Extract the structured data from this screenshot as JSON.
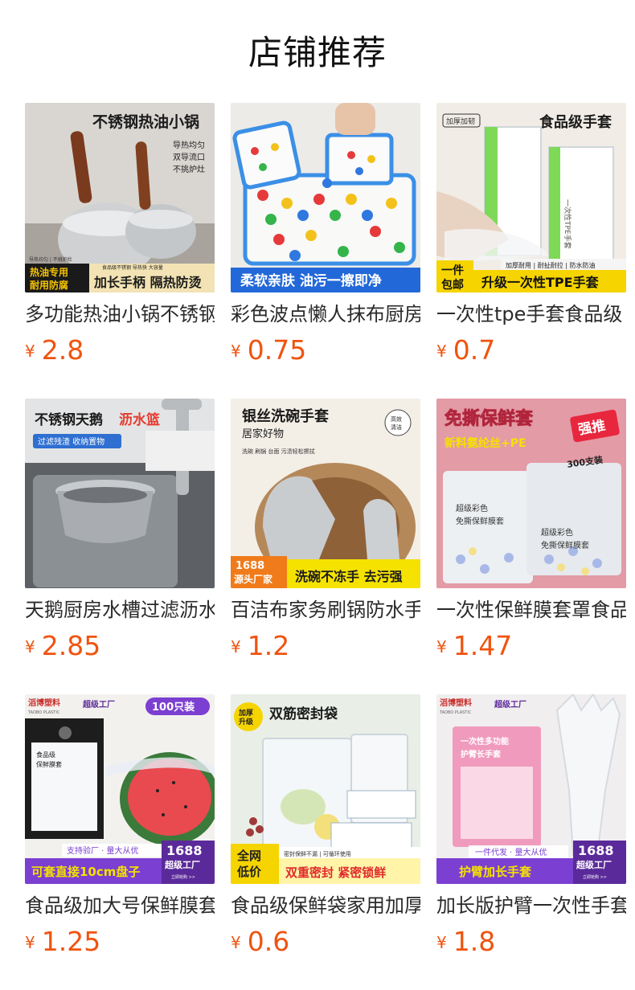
{
  "section": {
    "title": "店铺推荐"
  },
  "currency": "¥",
  "products": [
    {
      "name": "多功能热油小锅不锈钢",
      "price": "2.8",
      "image": {
        "headline": "不锈钢热油小锅",
        "bullets": [
          "导热均匀",
          "双导流口",
          "不挑炉灶"
        ],
        "tags": "导热均匀 | 不挑炉灶",
        "corner": [
          "热油专用",
          "耐用防腐"
        ],
        "subline": "食品级不锈钢 导热快 大容量",
        "banner": "加长手柄 隔热防烫"
      }
    },
    {
      "name": "彩色波点懒人抹布厨房",
      "price": "0.75",
      "image": {
        "banner": "柔软亲肤 油污一擦即净"
      }
    },
    {
      "name": "一次性tpe手套食品级",
      "price": "0.7",
      "image": {
        "badge": "加厚加韧",
        "headline": "食品级手套",
        "box_text": "一次性TPE手套",
        "mini_tags": "加厚耐用 | 耐扯耐拉 | 防水防油",
        "corner": [
          "一件",
          "包邮"
        ],
        "banner": "升级一次性TPE手套"
      }
    },
    {
      "name": "天鹅厨房水槽过滤沥水篮",
      "price": "2.85",
      "image": {
        "headline_main": "不锈钢天鹅",
        "headline_accent": "沥水篮",
        "subline": "过滤残渣 收纳置物"
      }
    },
    {
      "name": "百洁布家务刷锅防水手套",
      "price": "1.2",
      "image": {
        "headline": "银丝洗碗手套",
        "subhead": "居家好物",
        "uses": "洗碗 刷锅 台面 污渍轻松擦拭",
        "stamp": [
          "高效",
          "清洁"
        ],
        "corner": [
          "1688",
          "源头厂家"
        ],
        "banner": "洗碗不冻手 去污强"
      }
    },
    {
      "name": "一次性保鲜膜套罩食品",
      "price": "1.47",
      "image": {
        "headline": "免撕保鲜套",
        "subline": "新料氨纶丝+PE",
        "stamp": "强推",
        "count": "300支装",
        "pack_text": [
          "超级彩色",
          "免撕保鲜膜套"
        ]
      }
    },
    {
      "name": "食品级加大号保鲜膜套罩",
      "price": "1.25",
      "image": {
        "brand": "滔博塑料",
        "brand_en": "TAOBO PLASTIC",
        "factory": "超级工厂",
        "count": "100只装",
        "pack_text": [
          "食品级",
          "保鲜膜套"
        ],
        "slogan": "支持验厂 · 量大从优",
        "banner": "可套直接10cm盘子",
        "badge": [
          "1688",
          "超级工厂"
        ],
        "badge_link": "立即抢购 >>"
      }
    },
    {
      "name": "食品级保鲜袋家用加厚",
      "price": "0.6",
      "image": {
        "corner": [
          "加厚",
          "升级"
        ],
        "headline": "双筋密封袋",
        "side": [
          "全网",
          "低价"
        ],
        "subline": "密封保鲜不漏 | 可循环使用",
        "banner": "双重密封 紧密锁鲜"
      }
    },
    {
      "name": "加长版护臂一次性手套",
      "price": "1.8",
      "image": {
        "brand": "滔博塑料",
        "brand_en": "TAOBO PLASTIC",
        "factory": "超级工厂",
        "pack_text": [
          "一次性多功能",
          "护臂长手套"
        ],
        "slogan": "一件代发 · 量大从优",
        "banner": "护臂加长手套",
        "badge": [
          "1688",
          "超级工厂"
        ],
        "badge_link": "立即抢购 >>"
      }
    }
  ],
  "colors": {
    "price": "#ef5410",
    "title": "#111111",
    "name": "#2a2a2a",
    "accent_blue": "#2368d8",
    "accent_purple": "#7b3fd1"
  }
}
